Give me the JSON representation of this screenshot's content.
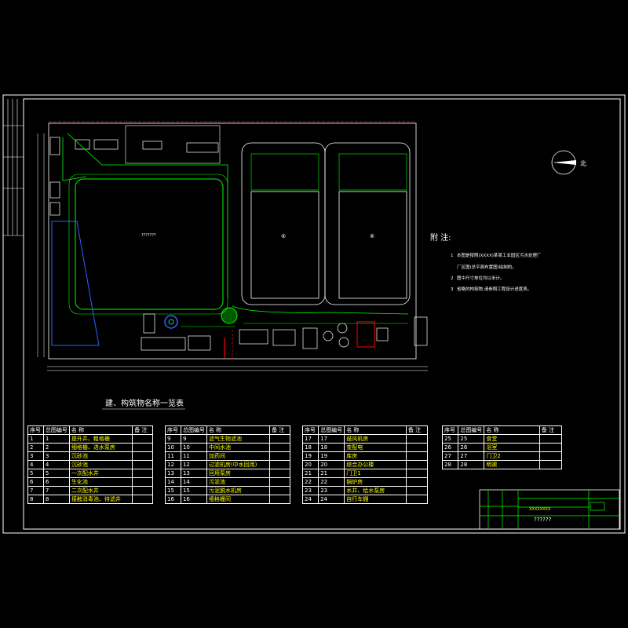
{
  "drawing": {
    "north_label": "北",
    "notes_title": "附 注:",
    "notes": [
      {
        "num": "1",
        "text": "本图是按照(XXXX)某某工业园区污水处理厂"
      },
      {
        "num": "",
        "text": "厂区图(总平面布置图)绘制的。"
      },
      {
        "num": "2",
        "text": "图中尺寸单位均以米计。"
      },
      {
        "num": "3",
        "text": "省略的构筑物,请参照工程设计进度表。"
      }
    ],
    "table_title": "建、构筑物名称一览表",
    "table_headers": [
      "序号",
      "总图编号",
      "名  称",
      "备 注"
    ],
    "tables": [
      [
        [
          "1",
          "1",
          "提升井、粗格栅",
          ""
        ],
        [
          "2",
          "2",
          "细格栅、进水泵房",
          ""
        ],
        [
          "3",
          "3",
          "沉砂池",
          ""
        ],
        [
          "4",
          "4",
          "沉砂池",
          ""
        ],
        [
          "5",
          "5",
          "一次配水井",
          ""
        ],
        [
          "6",
          "6",
          "生化池",
          ""
        ],
        [
          "7",
          "7",
          "二次配水井",
          ""
        ],
        [
          "8",
          "8",
          "接触消毒池、待滤井",
          ""
        ]
      ],
      [
        [
          "9",
          "9",
          "滤气生物滤池",
          ""
        ],
        [
          "10",
          "10",
          "中间水池",
          ""
        ],
        [
          "11",
          "11",
          "加药间",
          ""
        ],
        [
          "12",
          "12",
          "过滤机房(中水回用)",
          ""
        ],
        [
          "13",
          "13",
          "回用泵房",
          ""
        ],
        [
          "14",
          "14",
          "污泥池",
          ""
        ],
        [
          "15",
          "15",
          "污泥脱水机房",
          ""
        ],
        [
          "16",
          "16",
          "细格栅间",
          ""
        ]
      ],
      [
        [
          "17",
          "17",
          "鼓风机房",
          ""
        ],
        [
          "18",
          "18",
          "变配电",
          ""
        ],
        [
          "19",
          "19",
          "库房",
          ""
        ],
        [
          "20",
          "20",
          "综合办公楼",
          ""
        ],
        [
          "21",
          "21",
          "门卫1",
          ""
        ],
        [
          "22",
          "22",
          "锅炉房",
          ""
        ],
        [
          "23",
          "23",
          "水井、给水泵房",
          ""
        ],
        [
          "24",
          "24",
          "自行车棚",
          ""
        ]
      ],
      [
        [
          "25",
          "25",
          "食堂",
          ""
        ],
        [
          "26",
          "26",
          "浴室",
          ""
        ],
        [
          "27",
          "27",
          "门卫2",
          ""
        ],
        [
          "28",
          "28",
          "明渠",
          ""
        ]
      ]
    ],
    "title_block": {
      "project": "XXXXXXXX",
      "drawing_name": "??????"
    },
    "plan_labels": {
      "pond": "???????",
      "tank_left": "⑥",
      "tank_right": "⑥"
    }
  },
  "colors": {
    "frame": "#ffffff",
    "green": "#00ff00",
    "red": "#ff0000",
    "yellow": "#ffff00",
    "cyan": "#00ffff",
    "blue": "#3060ff",
    "magenta": "#ff00ff"
  }
}
